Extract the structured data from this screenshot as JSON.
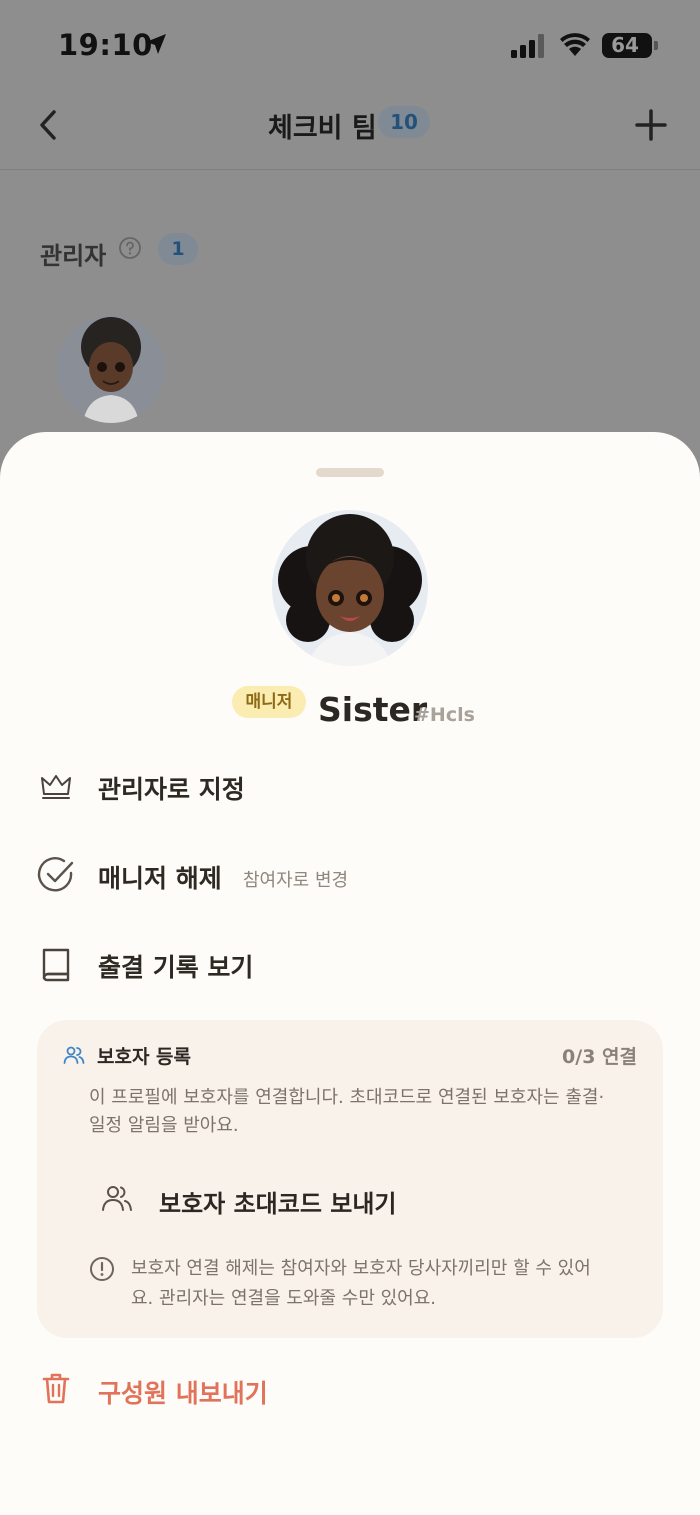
{
  "status_bar": {
    "time": "19:10",
    "battery": "64"
  },
  "nav": {
    "title": "체크비 팀",
    "member_count": "10"
  },
  "admin_section": {
    "title": "관리자",
    "count": "1"
  },
  "profile": {
    "role_badge": "매니저",
    "name": "Sister",
    "tag": "#Hcls"
  },
  "actions": {
    "set_admin": "관리자로 지정",
    "release_manager": "매니저 해제",
    "release_manager_sub": "참여자로 변경",
    "attendance": "출결 기록 보기"
  },
  "guardian": {
    "title": "보호자 등록",
    "status": "0/3 연결",
    "description": "이 프로필에 보호자를 연결합니다. 초대코드로 연결된 보호자는 출결·일정 알림을 받아요.",
    "invite_label": "보호자 초대코드 보내기",
    "note": "보호자 연결 해제는 참여자와 보호자 당사자끼리만 할 수 있어요. 관리자는 연결을 도와줄 수만 있어요."
  },
  "remove_member": "구성원 내보내기",
  "colors": {
    "danger": "#e0735a",
    "manager_badge_bg": "#fbecb2",
    "sheet_bg": "#fdfcf8",
    "card_bg": "#f9f2ea"
  }
}
